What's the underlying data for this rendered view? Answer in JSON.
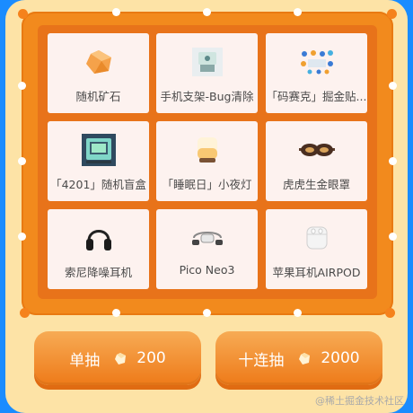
{
  "prizes": [
    {
      "label": "随机矿石",
      "icon": "ore-icon"
    },
    {
      "label": "手机支架-Bug清除",
      "icon": "phone-stand-icon"
    },
    {
      "label": "「码赛克」掘金贴...",
      "icon": "stickers-icon"
    },
    {
      "label": "「4201」随机盲盒",
      "icon": "blind-box-icon"
    },
    {
      "label": "「睡眠日」小夜灯",
      "icon": "night-light-icon"
    },
    {
      "label": "虎虎生金眼罩",
      "icon": "eye-mask-icon"
    },
    {
      "label": "索尼降噪耳机",
      "icon": "headphones-icon"
    },
    {
      "label": "Pico Neo3",
      "icon": "vr-headset-icon"
    },
    {
      "label": "苹果耳机AIRPOD",
      "icon": "airpods-icon"
    }
  ],
  "buttons": {
    "single": {
      "label": "单抽",
      "cost": "200"
    },
    "ten": {
      "label": "十连抽",
      "cost": "2000"
    }
  },
  "watermark": "@稀土掘金技术社区",
  "colors": {
    "background": "#1a8cff",
    "frame": "#f28a1d",
    "board": "#e8731a",
    "cell": "#fdf2ef",
    "machine": "#fde3a6"
  }
}
